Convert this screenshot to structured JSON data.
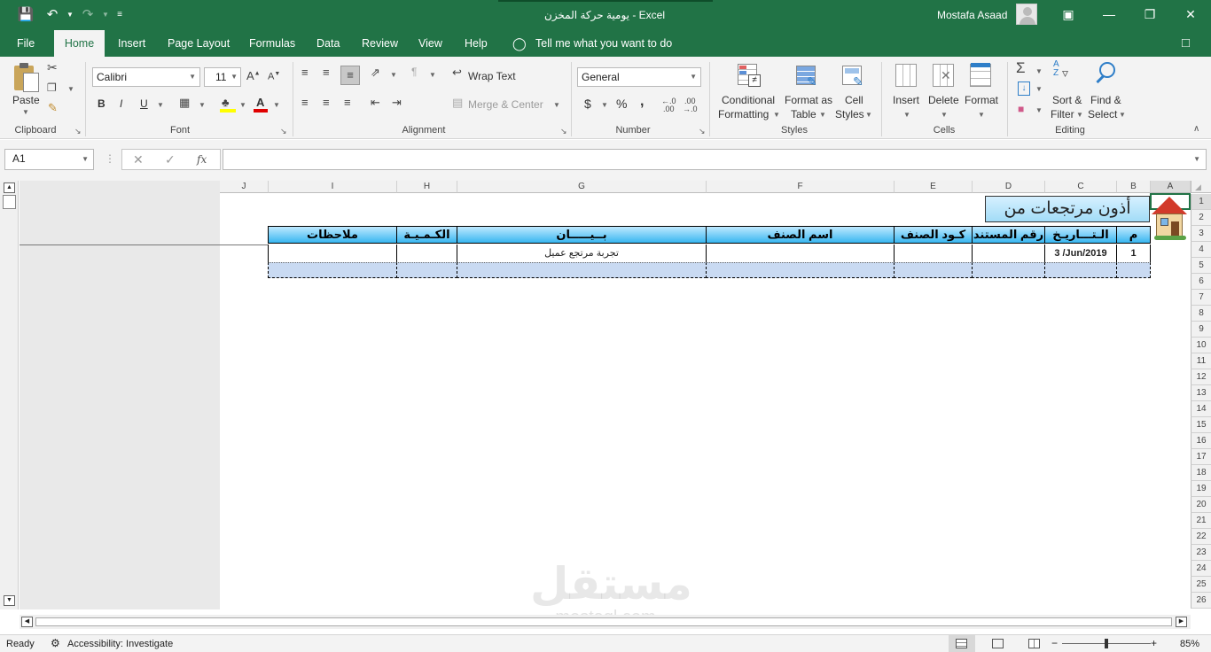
{
  "window": {
    "title": "يومية حركة المخزن  -  Excel",
    "user": "Mostafa Asaad"
  },
  "tabs": [
    "File",
    "Home",
    "Insert",
    "Page Layout",
    "Formulas",
    "Data",
    "Review",
    "View",
    "Help"
  ],
  "tell_me": "Tell me what you want to do",
  "ribbon": {
    "clipboard": {
      "paste": "Paste",
      "label": "Clipboard"
    },
    "font": {
      "name": "Calibri",
      "size": "11",
      "bold": "B",
      "italic": "I",
      "underline": "U",
      "label": "Font"
    },
    "alignment": {
      "wrap": "Wrap Text",
      "merge": "Merge & Center",
      "label": "Alignment"
    },
    "number": {
      "format": "General",
      "currency": "$",
      "percent": "%",
      "comma": ",",
      "label": "Number"
    },
    "styles": {
      "conditional_1": "Conditional",
      "conditional_2": "Formatting",
      "format_table_1": "Format as",
      "format_table_2": "Table",
      "cell_styles_1": "Cell",
      "cell_styles_2": "Styles",
      "label": "Styles"
    },
    "cells": {
      "insert": "Insert",
      "delete": "Delete",
      "format": "Format",
      "label": "Cells"
    },
    "editing": {
      "sort_1": "Sort &",
      "sort_2": "Filter",
      "find_1": "Find &",
      "find_2": "Select",
      "label": "Editing"
    }
  },
  "formula_bar": {
    "name_box": "A1",
    "fx": "fx",
    "value": ""
  },
  "sheet": {
    "columns": [
      "J",
      "I",
      "H",
      "G",
      "F",
      "E",
      "D",
      "C",
      "B",
      "A"
    ],
    "rows": [
      "1",
      "2",
      "3",
      "4",
      "5",
      "6",
      "7",
      "8",
      "9",
      "10",
      "11",
      "12",
      "13",
      "14",
      "15",
      "16",
      "17",
      "18",
      "19",
      "20",
      "21",
      "22",
      "23",
      "24",
      "25",
      "26"
    ],
    "banner": "أذون مرتجعات من",
    "headers": {
      "notes": "ملاحظات",
      "qty": "الكـمـيـة",
      "desc": "بــيـــــان",
      "item_name": "اسم الصنف",
      "item_code": "كـود  الصنف",
      "doc_no": "رقم المستند",
      "date": "الـتـــاريـخ",
      "no": "م"
    },
    "row4": {
      "desc": "تجربة مرتجع عميل",
      "date": "3 /Jun/2019",
      "no": "1"
    },
    "watermark_1": "مستقل",
    "watermark_2": "mostaql.com"
  },
  "status": {
    "ready": "Ready",
    "accessibility": "Accessibility: Investigate",
    "zoom": "85%"
  },
  "colors": {
    "excel_green": "#217346",
    "header_blue": "#38b6f0",
    "row_blue": "#c9daf2"
  }
}
